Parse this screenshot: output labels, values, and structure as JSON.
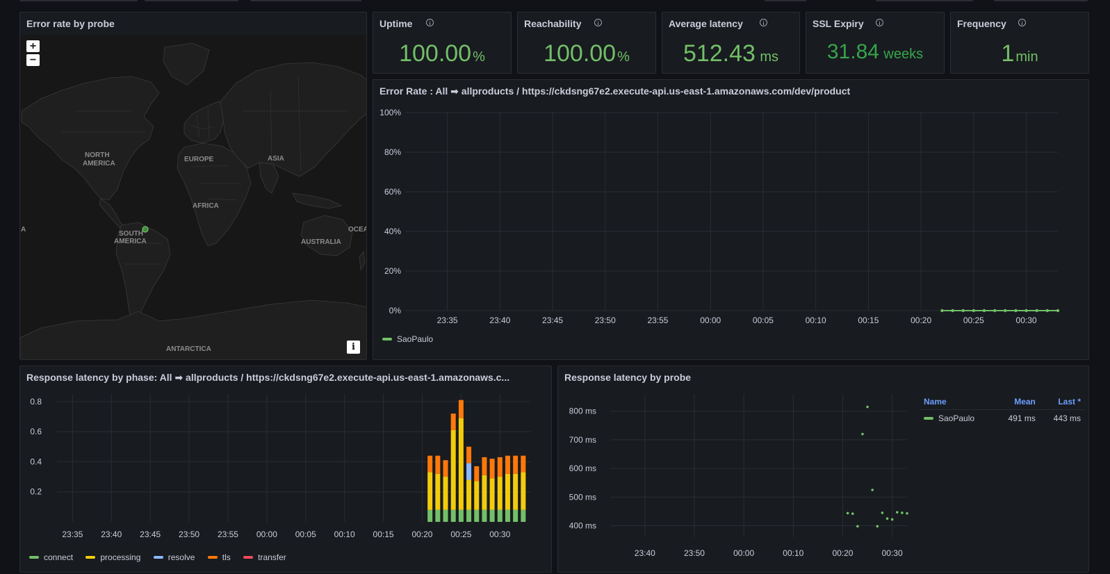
{
  "colors": {
    "green": "#73bf69",
    "green_dark": "#37a54d",
    "connect": "#73bf69",
    "processing": "#f2cc0c",
    "resolve": "#8ab8ff",
    "tls": "#ff780a",
    "transfer": "#f2495c"
  },
  "map": {
    "title": "Error rate by probe",
    "zoom_in": "+",
    "zoom_out": "−",
    "attribution": "i",
    "labels": {
      "north_america_1": "NORTH",
      "north_america_2": "AMERICA",
      "europe": "EUROPE",
      "asia": "ASIA",
      "africa": "AFRICA",
      "south_america_1": "SOUTH",
      "south_america_2": "AMERICA",
      "australia": "AUSTRALIA",
      "antarctica": "ANTARCTICA",
      "edge_left": "A",
      "edge_right": "OCEA"
    }
  },
  "stats": [
    {
      "title": "Uptime",
      "value": "100.00",
      "unit": "%"
    },
    {
      "title": "Reachability",
      "value": "100.00",
      "unit": "%"
    },
    {
      "title": "Average latency",
      "value": "512.43",
      "unit": "ms"
    },
    {
      "title": "SSL Expiry",
      "value": "31.84",
      "unit": "weeks"
    },
    {
      "title": "Frequency",
      "value": "1",
      "unit": "min"
    }
  ],
  "error_rate": {
    "title": "Error Rate : All ➡ allproducts / https://ckdsng67e2.execute-api.us-east-1.amazonaws.com/dev/product",
    "legend": "SaoPaulo"
  },
  "latency_phase": {
    "title": "Response latency by phase: All ➡ allproducts / https://ckdsng67e2.execute-api.us-east-1.amazonaws.c...",
    "legend": [
      "connect",
      "processing",
      "resolve",
      "tls",
      "transfer"
    ]
  },
  "latency_probe": {
    "title": "Response latency by probe",
    "table": {
      "headers": [
        "Name",
        "Mean",
        "Last *"
      ],
      "row": {
        "name": "SaoPaulo",
        "mean": "491 ms",
        "last": "443 ms"
      }
    }
  },
  "chart_data": [
    {
      "type": "line",
      "title": "Error Rate : All ➡ allproducts / https://ckdsng67e2.execute-api.us-east-1.amazonaws.com/dev/product",
      "x_ticks": [
        "23:35",
        "23:40",
        "23:45",
        "23:50",
        "23:55",
        "00:00",
        "00:05",
        "00:10",
        "00:15",
        "00:20",
        "00:25",
        "00:30"
      ],
      "y_ticks": [
        "0%",
        "20%",
        "40%",
        "60%",
        "80%",
        "100%"
      ],
      "ylim": [
        0,
        100
      ],
      "series": [
        {
          "name": "SaoPaulo",
          "x": [
            "00:22",
            "00:23",
            "00:24",
            "00:25",
            "00:26",
            "00:27",
            "00:28",
            "00:29",
            "00:30",
            "00:31",
            "00:32",
            "00:33"
          ],
          "values": [
            0,
            0,
            0,
            0,
            0,
            0,
            0,
            0,
            0,
            0,
            0,
            0
          ]
        }
      ]
    },
    {
      "type": "bar",
      "title": "Response latency by phase: All ➡ allproducts / https://ckdsng67e2.execute-api.us-east-1.amazonaws.c...",
      "stacked": true,
      "x_ticks": [
        "23:35",
        "23:40",
        "23:45",
        "23:50",
        "23:55",
        "00:00",
        "00:05",
        "00:10",
        "00:15",
        "00:20",
        "00:25",
        "00:30"
      ],
      "y_ticks": [
        "0.2",
        "0.4",
        "0.6",
        "0.8"
      ],
      "ylim": [
        0,
        0.85
      ],
      "categories": [
        "00:21",
        "00:22",
        "00:23",
        "00:24",
        "00:25",
        "00:26",
        "00:27",
        "00:28",
        "00:29",
        "00:30",
        "00:31",
        "00:32",
        "00:33"
      ],
      "series": [
        {
          "name": "connect",
          "values": [
            0.08,
            0.08,
            0.08,
            0.08,
            0.08,
            0.08,
            0.08,
            0.08,
            0.08,
            0.08,
            0.08,
            0.08,
            0.08
          ]
        },
        {
          "name": "processing",
          "values": [
            0.25,
            0.24,
            0.22,
            0.53,
            0.61,
            0.2,
            0.19,
            0.23,
            0.21,
            0.22,
            0.24,
            0.24,
            0.25
          ]
        },
        {
          "name": "resolve",
          "values": [
            0,
            0,
            0,
            0,
            0,
            0.11,
            0,
            0,
            0,
            0,
            0,
            0,
            0
          ]
        },
        {
          "name": "tls",
          "values": [
            0.11,
            0.12,
            0.11,
            0.11,
            0.12,
            0.11,
            0.1,
            0.12,
            0.13,
            0.13,
            0.12,
            0.12,
            0.11
          ]
        },
        {
          "name": "transfer",
          "values": [
            0,
            0,
            0,
            0,
            0,
            0,
            0,
            0,
            0,
            0,
            0,
            0,
            0
          ]
        }
      ]
    },
    {
      "type": "scatter",
      "title": "Response latency by probe",
      "x_ticks": [
        "23:40",
        "23:50",
        "00:00",
        "00:10",
        "00:20",
        "00:30"
      ],
      "y_ticks": [
        "400 ms",
        "500 ms",
        "600 ms",
        "700 ms",
        "800 ms"
      ],
      "ylim": [
        360,
        860
      ],
      "series": [
        {
          "name": "SaoPaulo",
          "x": [
            "00:21",
            "00:22",
            "00:23",
            "00:24",
            "00:25",
            "00:26",
            "00:27",
            "00:28",
            "00:29",
            "00:30",
            "00:31",
            "00:32",
            "00:33"
          ],
          "values": [
            444,
            442,
            398,
            720,
            815,
            525,
            398,
            445,
            425,
            422,
            447,
            445,
            443
          ]
        }
      ]
    }
  ]
}
